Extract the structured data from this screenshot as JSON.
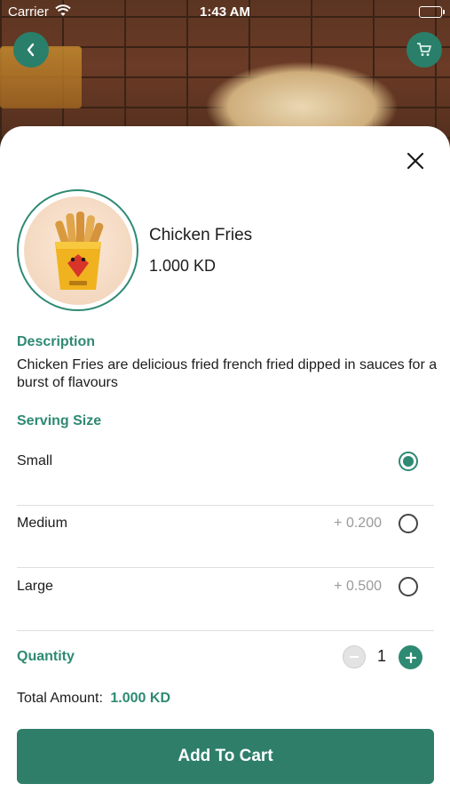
{
  "status_bar": {
    "carrier": "Carrier",
    "time": "1:43 AM"
  },
  "header": {
    "back_icon": "chevron-left-icon",
    "cart_icon": "cart-icon",
    "accent": "#2e8a72"
  },
  "product": {
    "name": "Chicken Fries",
    "price": "1.000 KD",
    "image_icon": "fries-box-icon"
  },
  "description": {
    "label": "Description",
    "text": "Chicken Fries are delicious fried french fried dipped in sauces for a burst of flavours"
  },
  "serving_size": {
    "label": "Serving Size",
    "options": [
      {
        "name": "Small",
        "price": "",
        "selected": true
      },
      {
        "name": "Medium",
        "price": "+ 0.200",
        "selected": false
      },
      {
        "name": "Large",
        "price": "+ 0.500",
        "selected": false
      }
    ]
  },
  "quantity": {
    "label": "Quantity",
    "value": "1"
  },
  "total": {
    "label": "Total Amount:",
    "amount": "1.000 KD"
  },
  "actions": {
    "add_to_cart": "Add To Cart"
  }
}
